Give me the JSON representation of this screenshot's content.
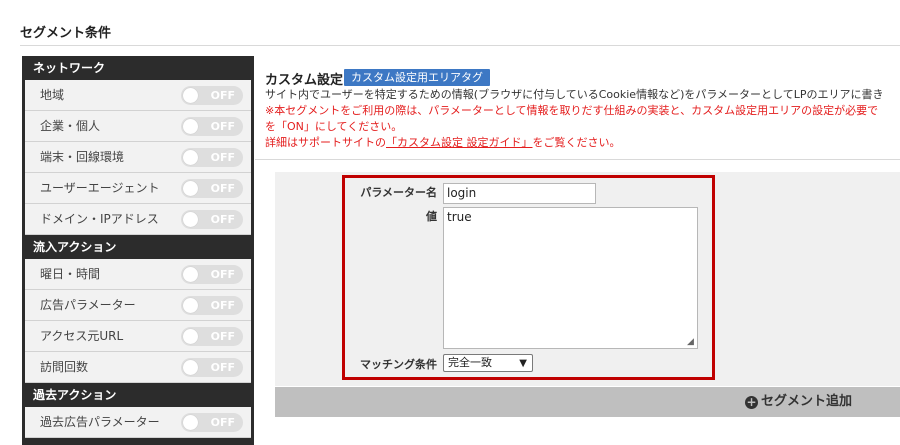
{
  "page": {
    "title": "セグメント条件"
  },
  "sidebar": {
    "sections": [
      {
        "title": "ネットワーク",
        "items": [
          {
            "label": "地域",
            "state": "OFF"
          },
          {
            "label": "企業・個人",
            "state": "OFF"
          },
          {
            "label": "端末・回線環境",
            "state": "OFF"
          },
          {
            "label": "ユーザーエージェント",
            "state": "OFF"
          },
          {
            "label": "ドメイン・IPアドレス",
            "state": "OFF"
          }
        ]
      },
      {
        "title": "流入アクション",
        "items": [
          {
            "label": "曜日・時間",
            "state": "OFF"
          },
          {
            "label": "広告パラメーター",
            "state": "OFF"
          },
          {
            "label": "アクセス元URL",
            "state": "OFF"
          },
          {
            "label": "訪問回数",
            "state": "OFF"
          }
        ]
      },
      {
        "title": "過去アクション",
        "items": [
          {
            "label": "過去広告パラメーター",
            "state": "OFF"
          }
        ]
      }
    ]
  },
  "custom": {
    "title": "カスタム設定",
    "tag_button": "カスタム設定用エリアタグ",
    "description": "サイト内でユーザーを特定するための情報(ブラウザに付与しているCookie情報など)をパラメーターとしてLPのエリアに書き",
    "warning_line1": "※本セグメントをご利用の際は、パラメーターとして情報を取りだす仕組みの実装と、カスタム設定用エリアの設定が必要で",
    "warning_line2": "を「ON」にしてください。",
    "guide_prefix": "詳細はサポートサイトの",
    "guide_link": "「カスタム設定 設定ガイド」",
    "guide_suffix": "をご覧ください。"
  },
  "form": {
    "param_label": "パラメーター名",
    "param_value": "login",
    "value_label": "値",
    "value_text": "true",
    "match_label": "マッチング条件",
    "match_selected": "完全一致"
  },
  "actions": {
    "add_segment": "セグメント追加"
  },
  "colors": {
    "accent_blue": "#3d78c4",
    "highlight_red": "#c00000",
    "warning_text": "#e41d1d",
    "sidebar_dark": "#2c2c2c"
  }
}
